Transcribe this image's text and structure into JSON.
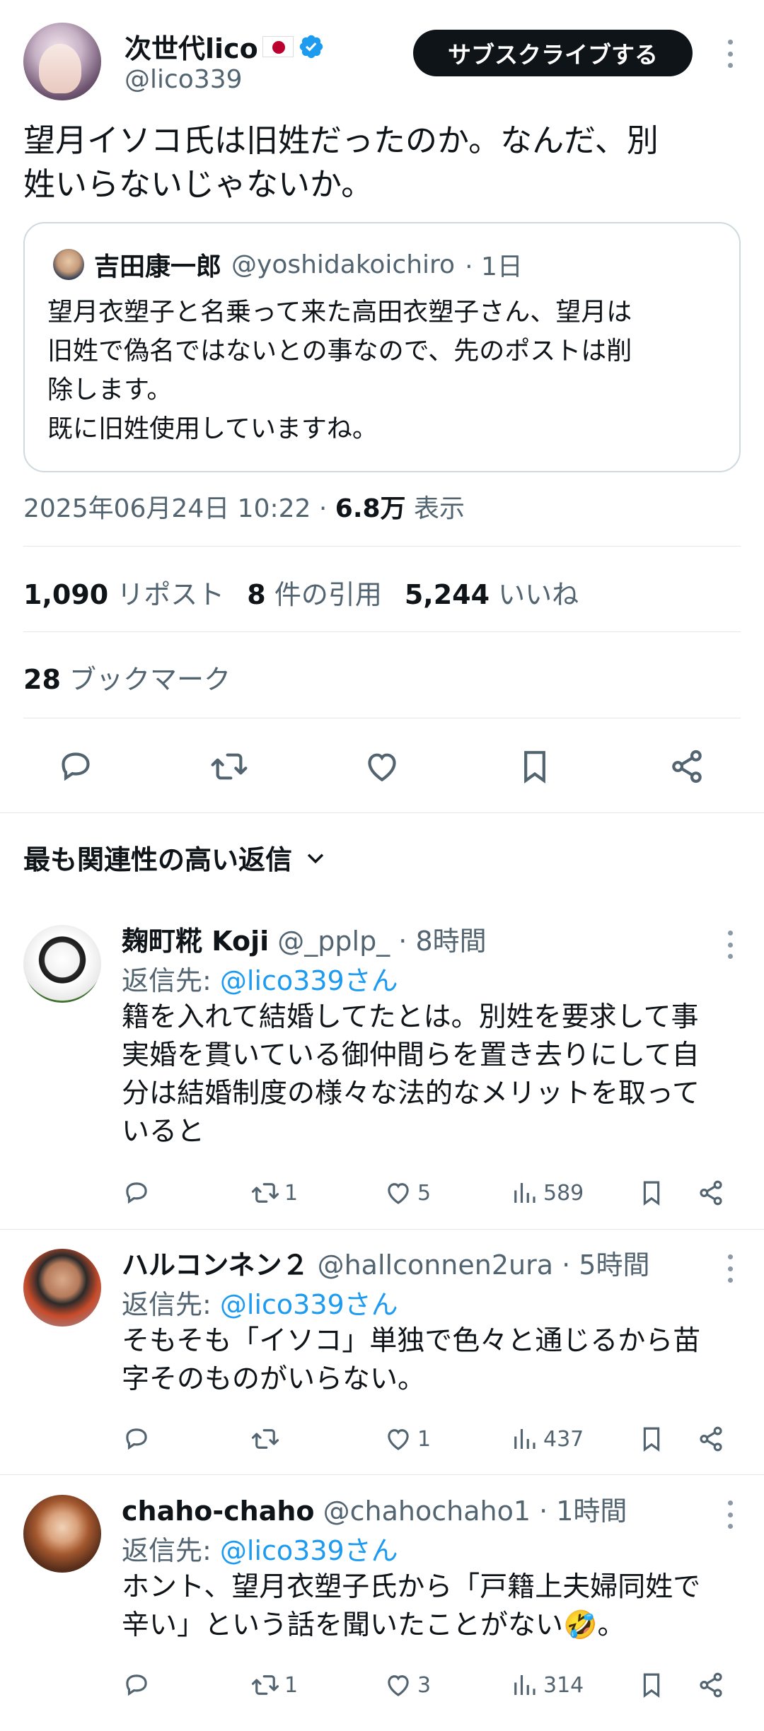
{
  "post": {
    "display_name": "次世代lico",
    "handle": "@lico339",
    "subscribe_label": "サブスクライブする",
    "text_line1": "望月イソコ氏は旧姓だったのか。なんだ、別",
    "text_line2": "姓いらないじゃないか。",
    "quote": {
      "name": "吉田康一郎",
      "handle": "@yoshidakoichiro",
      "time": "· 1日",
      "lines": [
        "望月衣塑子と名乗って来た高田衣塑子さん、望月は",
        "旧姓で偽名ではないとの事なので、先のポストは削",
        "除します。",
        "既に旧姓使用していますね。"
      ]
    },
    "timestamp": "2025年06月24日 10:22 · ",
    "views_count": "6.8万",
    "views_label": " 表示",
    "reposts_count": "1,090",
    "reposts_label": " リポスト",
    "quotes_count": "8",
    "quotes_label": " 件の引用",
    "likes_count": "5,244",
    "likes_label": " いいね",
    "bookmarks_count": "28",
    "bookmarks_label": " ブックマーク"
  },
  "replies_section_title": "最も関連性の高い返信",
  "replies": [
    {
      "name": "麹町糀 Koji",
      "handle": "@_pplp_",
      "time": "· 8時間",
      "reply_to_label": "返信先: ",
      "reply_to": "@lico339さん",
      "lines": [
        "籍を入れて結婚してたとは。別姓を要求して事",
        "実婚を貫いている御仲間らを置き去りにして自",
        "分は結婚制度の様々な法的なメリットを取って",
        "いると"
      ],
      "reposts": "1",
      "likes": "5",
      "views": "589"
    },
    {
      "name": "ハルコンネン２",
      "handle": "@hallconnen2ura",
      "time": "· 5時間",
      "reply_to_label": "返信先: ",
      "reply_to": "@lico339さん",
      "lines": [
        "そもそも「イソコ」単独で色々と通じるから苗",
        "字そのものがいらない。"
      ],
      "reposts": "",
      "likes": "1",
      "views": "437"
    },
    {
      "name": "chaho-chaho",
      "handle": "@chahochaho1",
      "time": "· 1時間",
      "reply_to_label": "返信先: ",
      "reply_to": "@lico339さん",
      "lines": [
        "ホント、望月衣塑子氏から「戸籍上夫婦同姓で",
        "辛い」という話を聞いたことがない🤣。"
      ],
      "reposts": "1",
      "likes": "3",
      "views": "314"
    }
  ],
  "colors": {
    "text": "#0f1419",
    "muted": "#536471",
    "link": "#1d9bf0",
    "verified": "#1d9bf0",
    "border": "#cfd9de"
  }
}
